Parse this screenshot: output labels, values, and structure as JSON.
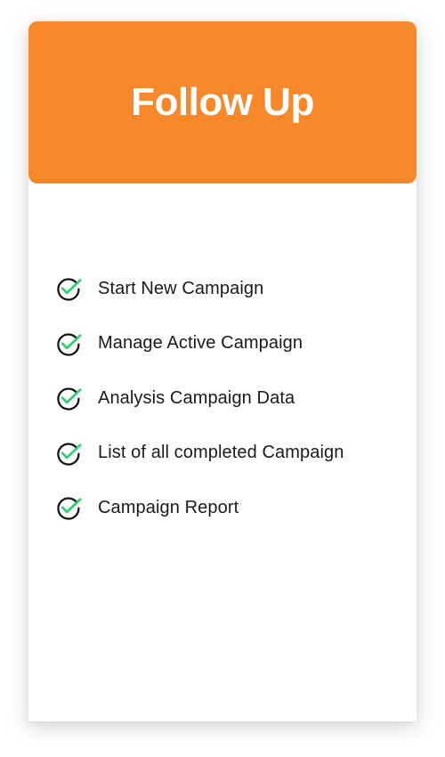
{
  "colors": {
    "accent": "#F7882A",
    "check_green": "#22D36A",
    "check_outline": "#111111",
    "text": "#1a1a1a"
  },
  "card": {
    "title": "Follow Up",
    "features": [
      {
        "label": "Start New Campaign",
        "icon": "check-circle-icon"
      },
      {
        "label": "Manage Active Campaign",
        "icon": "check-circle-icon"
      },
      {
        "label": "Analysis Campaign Data",
        "icon": "check-circle-icon"
      },
      {
        "label": "List of all completed Campaign",
        "icon": "check-circle-icon"
      },
      {
        "label": "Campaign Report",
        "icon": "check-circle-icon"
      }
    ]
  }
}
